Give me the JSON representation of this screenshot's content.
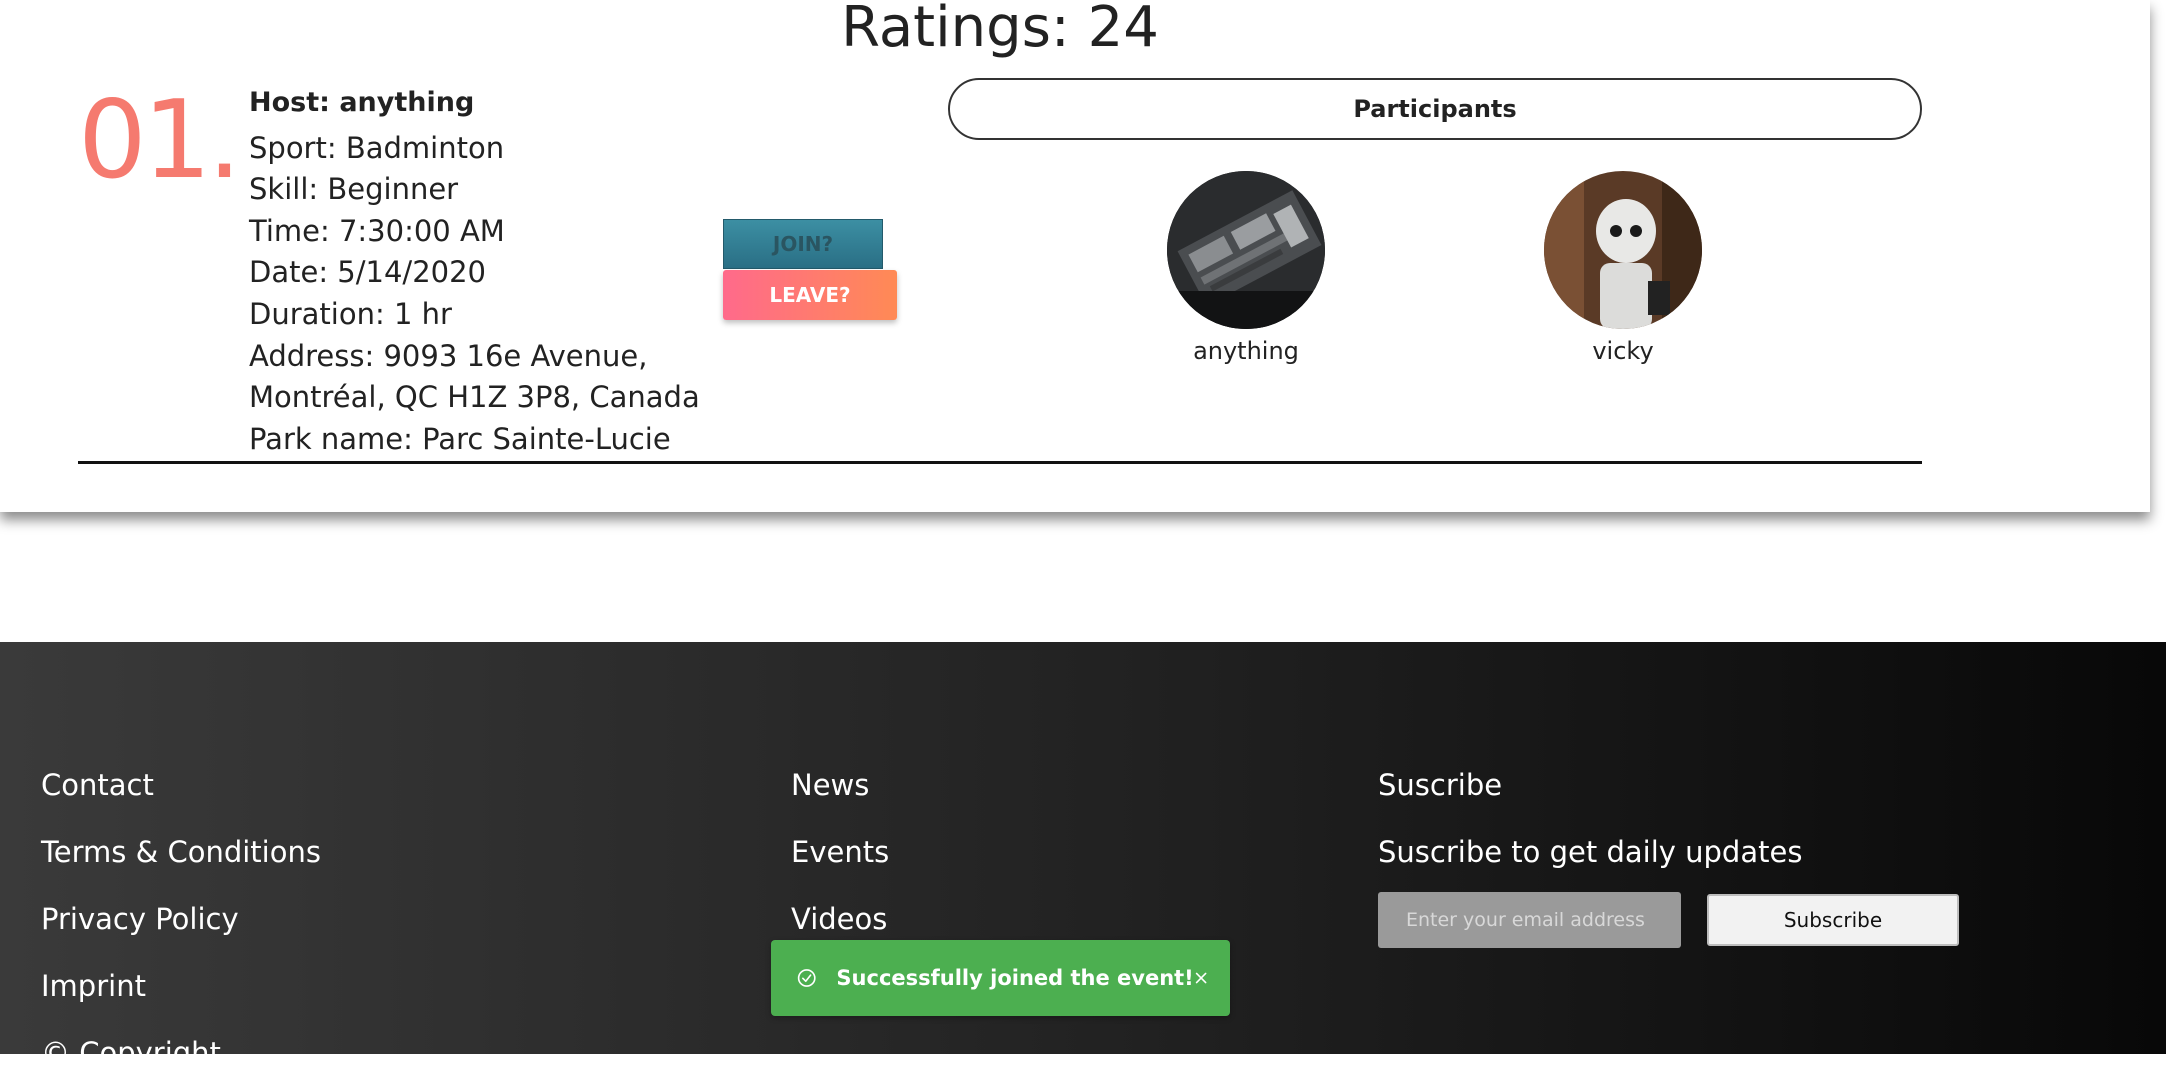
{
  "event": {
    "ratings": "Ratings: 24",
    "number": "01.",
    "host": "Host: anything",
    "sport": "Sport: Badminton",
    "skill": "Skill: Beginner",
    "time": "Time: 7:30:00 AM",
    "date": "Date: 5/14/2020",
    "duration": "Duration: 1 hr",
    "address_line1": "Address: 9093 16e Avenue,",
    "address_line2": "Montréal, QC H1Z 3P8, Canada",
    "park": "Park name: Parc Sainte-Lucie",
    "join_label": "JOIN?",
    "leave_label": "LEAVE?"
  },
  "participants": {
    "header": "Participants",
    "list": [
      {
        "name": "anything",
        "avatar": "circuit-board-photo"
      },
      {
        "name": "vicky",
        "avatar": "robot-photo"
      }
    ]
  },
  "footer": {
    "col1": [
      "Contact",
      "Terms & Conditions",
      "Privacy Policy",
      "Imprint",
      "© Copyright"
    ],
    "col2": [
      "News",
      "Events",
      "Videos"
    ],
    "subscribe_title": "Suscribe",
    "subscribe_subtitle": "Suscribe to get daily updates",
    "email_placeholder": "Enter your email address",
    "subscribe_button": "Subscribe"
  },
  "toast": {
    "message": "Successfully joined the event!",
    "color": "#4caf50"
  },
  "colors": {
    "event_number": "#f57a6f",
    "join_button": "#2f7d91",
    "leave_gradient_start": "#ff6a8b",
    "leave_gradient_end": "#ff8a55"
  }
}
